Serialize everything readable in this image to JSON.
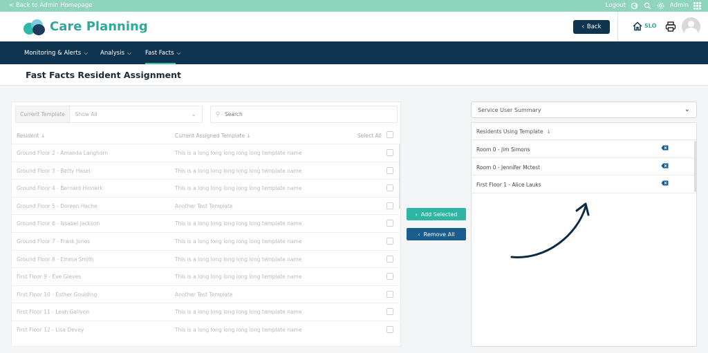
{
  "topbar": {
    "back_link": "< Back to Admin Homepage",
    "logout": "Logout",
    "user": "Admin"
  },
  "header": {
    "brand": "Care Planning",
    "back_button": "Back",
    "site_code": "SLO"
  },
  "nav": {
    "items": [
      {
        "label": "Monitoring & Alerts"
      },
      {
        "label": "Analysis"
      },
      {
        "label": "Fast Facts"
      }
    ],
    "active": "Fast Facts"
  },
  "page": {
    "title": "Fast Facts Resident Assignment"
  },
  "left": {
    "filter_label": "Current Template",
    "filter_value": "Show All",
    "search_placeholder": "Search",
    "columns": {
      "resident": "Resident",
      "template": "Current Assigned Template",
      "select_all": "Select All"
    },
    "rows": [
      {
        "resident": "Ground Floor 2 - Amanda Langhorn",
        "template": "This is a long long long long long template name"
      },
      {
        "resident": "Ground Floor 3 - Betty Hasel",
        "template": "This is a long long long long long template name"
      },
      {
        "resident": "Ground Floor 4 - Bernard Hinnerk",
        "template": "This is a long long long long long template name"
      },
      {
        "resident": "Ground Floor 5 - Doreen Hache",
        "template": "Another Test Template"
      },
      {
        "resident": "Ground Floor 6 - Issabel Jackson",
        "template": "This is a long long long long long template name"
      },
      {
        "resident": "Ground Floor 7 - Frank Jones",
        "template": "This is a long long long long long template name"
      },
      {
        "resident": "Ground Floor 8 - Emma Smith",
        "template": "This is a long long long long long template name"
      },
      {
        "resident": "First Floor 9 - Eve Gieves",
        "template": "This is a long long long long long template name"
      },
      {
        "resident": "First Floor 10 - Esther Goulding",
        "template": "Another Test Template"
      },
      {
        "resident": "First Floor 11 - Leah Gallyon",
        "template": "This is a long long long long long template name"
      },
      {
        "resident": "First Floor 12 - Lisa Devey",
        "template": "This is a long long long long long template name"
      }
    ]
  },
  "actions": {
    "add_selected": "Add Selected",
    "remove_all": "Remove All"
  },
  "right": {
    "summary_select": "Service User Summary",
    "list_header": "Residents Using Template",
    "rows": [
      {
        "name": "Room 0 - Jim Simons"
      },
      {
        "name": "Room 0 - Jennifer Mctest"
      },
      {
        "name": "First Floor 1 - Alice Lauks"
      }
    ]
  },
  "colors": {
    "navy": "#0e3450",
    "teal": "#2fb5a3",
    "mint_bar": "#8fd5bd",
    "remove_blue": "#1c5d8f"
  }
}
